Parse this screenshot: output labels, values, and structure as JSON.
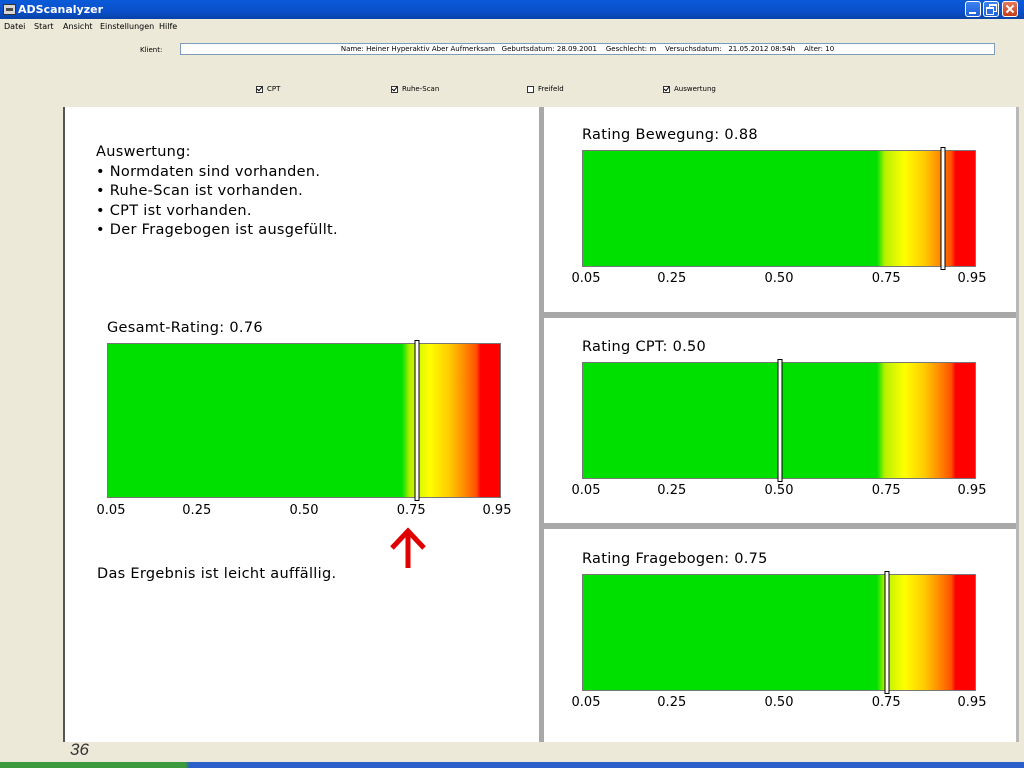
{
  "window": {
    "title": "ADScanalyzer"
  },
  "menu": [
    "Datei",
    "Start",
    "Ansicht",
    "Einstellungen",
    "Hilfe"
  ],
  "klient": {
    "label": "Klient:",
    "value": "Name: Heiner Hyperaktiv Aber Aufmerksam   Geburtsdatum: 28.09.2001    Geschlecht: m    Versuchsdatum:   21.05.2012 08:54h    Alter: 10"
  },
  "checkboxes": [
    {
      "label": "CPT",
      "checked": true
    },
    {
      "label": "Ruhe-Scan",
      "checked": true
    },
    {
      "label": "Freifeld",
      "checked": false
    },
    {
      "label": "Auswertung",
      "checked": true
    }
  ],
  "auswertung": {
    "heading": "Auswertung:",
    "items": [
      "• Normdaten sind vorhanden.",
      "• Ruhe-Scan ist vorhanden.",
      "• CPT ist vorhanden.",
      "• Der Fragebogen ist ausgefüllt."
    ]
  },
  "result_text": "Das Ergebnis ist leicht auffällig.",
  "ratings": {
    "gesamt": {
      "title": "Gesamt-Rating: 0.76",
      "value": 0.76
    },
    "bewegung": {
      "title": "Rating Bewegung: 0.88",
      "value": 0.88
    },
    "cpt": {
      "title": "Rating CPT: 0.50",
      "value": 0.5
    },
    "fragebogen": {
      "title": "Rating Fragebogen: 0.75",
      "value": 0.75
    }
  },
  "scale_ticks": [
    "0.05",
    "0.25",
    "0.50",
    "0.75",
    "0.95"
  ],
  "colors": {
    "green": "#00e000",
    "red": "#ff0000",
    "arrow": "#e00000"
  },
  "slide_number": "36"
}
